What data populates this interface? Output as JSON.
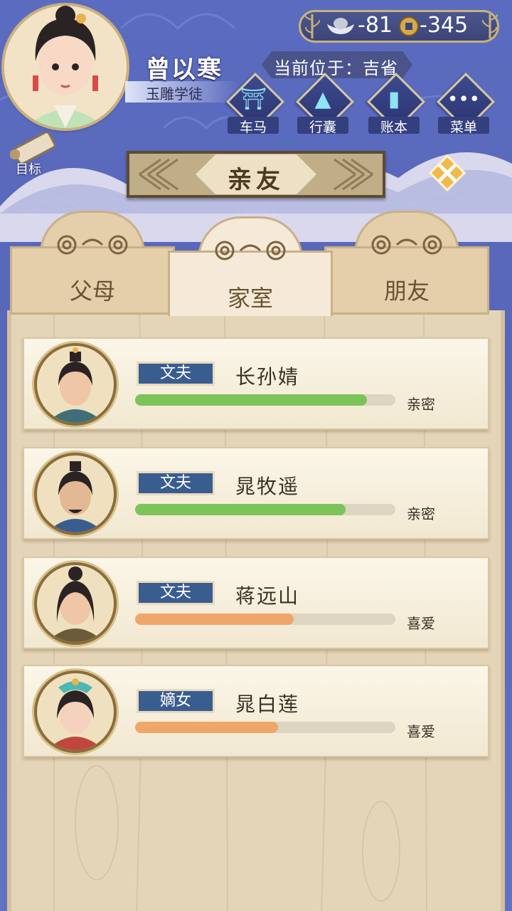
{
  "player": {
    "name": "曾以寒",
    "title": "玉雕学徒"
  },
  "currency": {
    "silver": "-81",
    "coins": "-345"
  },
  "location": {
    "label": "当前位于：吉省"
  },
  "nav": [
    {
      "label": "车马",
      "icon": "carriage-icon"
    },
    {
      "label": "行囊",
      "icon": "bag-icon"
    },
    {
      "label": "账本",
      "icon": "ledger-icon"
    },
    {
      "label": "菜单",
      "icon": "menu-icon"
    }
  ],
  "goal": {
    "label": "目标",
    "icon": "scroll-icon"
  },
  "page_title": "亲友",
  "tabs": [
    {
      "label": "父母",
      "active": false
    },
    {
      "label": "家室",
      "active": true
    },
    {
      "label": "朋友",
      "active": false
    }
  ],
  "relatives": [
    {
      "relation": "文夫",
      "name": "长孙婧",
      "status": "亲密",
      "affinity": 0.89,
      "bar_color": "#7cc35a"
    },
    {
      "relation": "文夫",
      "name": "晁牧遥",
      "status": "亲密",
      "affinity": 0.81,
      "bar_color": "#7cc35a"
    },
    {
      "relation": "文夫",
      "name": "蒋远山",
      "status": "喜爱",
      "affinity": 0.61,
      "bar_color": "#f0a66a"
    },
    {
      "relation": "嫡女",
      "name": "晁白莲",
      "status": "喜爱",
      "affinity": 0.55,
      "bar_color": "#f0a66a"
    }
  ],
  "colors": {
    "sky": "#5b6cc0",
    "panel": "#e5d5b8",
    "badge": "#3a5d8f"
  }
}
